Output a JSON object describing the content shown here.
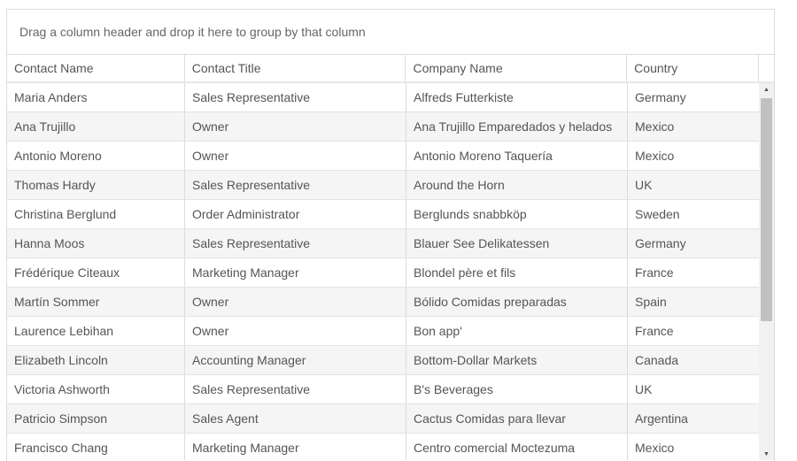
{
  "group_panel": {
    "text": "Drag a column header and drop it here to group by that column"
  },
  "columns": [
    "Contact Name",
    "Contact Title",
    "Company Name",
    "Country"
  ],
  "rows": [
    [
      "Maria Anders",
      "Sales Representative",
      "Alfreds Futterkiste",
      "Germany"
    ],
    [
      "Ana Trujillo",
      "Owner",
      "Ana Trujillo Emparedados y helados",
      "Mexico"
    ],
    [
      "Antonio Moreno",
      "Owner",
      "Antonio Moreno Taquería",
      "Mexico"
    ],
    [
      "Thomas Hardy",
      "Sales Representative",
      "Around the Horn",
      "UK"
    ],
    [
      "Christina Berglund",
      "Order Administrator",
      "Berglunds snabbköp",
      "Sweden"
    ],
    [
      "Hanna Moos",
      "Sales Representative",
      "Blauer See Delikatessen",
      "Germany"
    ],
    [
      "Frédérique Citeaux",
      "Marketing Manager",
      "Blondel père et fils",
      "France"
    ],
    [
      "Martín Sommer",
      "Owner",
      "Bólido Comidas preparadas",
      "Spain"
    ],
    [
      "Laurence Lebihan",
      "Owner",
      "Bon app'",
      "France"
    ],
    [
      "Elizabeth Lincoln",
      "Accounting Manager",
      "Bottom-Dollar Markets",
      "Canada"
    ],
    [
      "Victoria Ashworth",
      "Sales Representative",
      "B's Beverages",
      "UK"
    ],
    [
      "Patricio Simpson",
      "Sales Agent",
      "Cactus Comidas para llevar",
      "Argentina"
    ],
    [
      "Francisco Chang",
      "Marketing Manager",
      "Centro comercial Moctezuma",
      "Mexico"
    ]
  ],
  "scrollbar": {
    "up_icon": "scroll-up-arrow-icon",
    "down_icon": "scroll-down-arrow-icon"
  },
  "colors": {
    "border": "#dcdcdc",
    "alt_row": "#f5f5f5",
    "text": "#555555",
    "scroll_thumb": "#c1c1c1"
  }
}
